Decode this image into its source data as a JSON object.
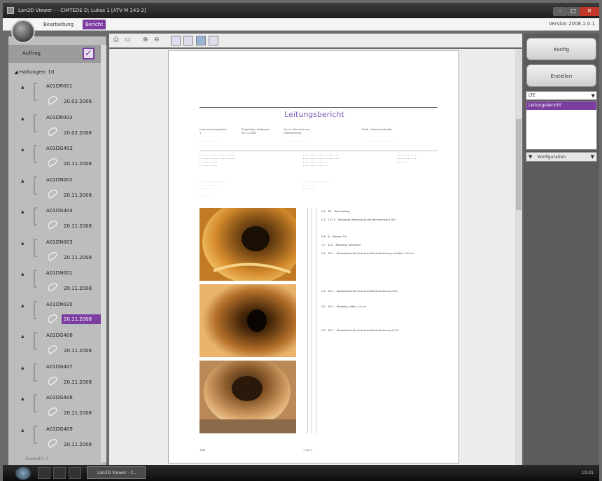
{
  "window": {
    "title": "Lan3D Viewer - - CIMTEDE D; Lukas 1 [ATV M 143-2]",
    "version": "Version 2008.1.0.1"
  },
  "appbar": {
    "tab_bearbeitung": "Bearbeitung",
    "tab_bericht": "Bericht"
  },
  "sidebar": {
    "auftrag_label": "Auftrag",
    "auftrag_checked": true,
    "haltungen_label": "Haltungen: 10",
    "items": [
      {
        "code": "A01DR001",
        "date": "20.02.2008",
        "selected": false
      },
      {
        "code": "A01DR003",
        "date": "20.02.2008",
        "selected": false
      },
      {
        "code": "A01DG403",
        "date": "20.11.2008",
        "selected": false
      },
      {
        "code": "A01DN002",
        "date": "20.11.2008",
        "selected": false
      },
      {
        "code": "A01DG404",
        "date": "20.11.2008",
        "selected": false
      },
      {
        "code": "A01DN003",
        "date": "20.11.2008",
        "selected": false
      },
      {
        "code": "A01DN001",
        "date": "20.11.2008",
        "selected": false
      },
      {
        "code": "A01DN020",
        "date": "20.11.2008",
        "selected": true
      },
      {
        "code": "A01DG406",
        "date": "20.11.2008",
        "selected": false
      },
      {
        "code": "A01DG407",
        "date": "20.11.2008",
        "selected": false
      },
      {
        "code": "A01DG408",
        "date": "20.11.2008",
        "selected": false
      },
      {
        "code": "A01DG409",
        "date": "20.11.2008",
        "selected": false
      }
    ]
  },
  "document": {
    "title": "Leitungsbericht",
    "header_fields": [
      {
        "label": "Untersuchungsdatum",
        "value": "1"
      },
      {
        "label": "Zugehörige Haltungen",
        "value": "20.11.2008"
      },
      {
        "label": "Grund Untersuchung",
        "value": "Untersuchung"
      },
      {
        "label": "Stadt / Gemeindestraße",
        "value": ""
      }
    ],
    "observations": [
      {
        "pos": "0,0",
        "code": "BC",
        "text": "Rohranfang"
      },
      {
        "pos": "0,1",
        "code": "13 LE",
        "text": "Fehlende Verbindung der Rohrleitung 3 Uhr"
      },
      {
        "pos": "0,6",
        "code": "A",
        "text": "Wasser 5%"
      },
      {
        "pos": "1,7",
        "code": "A-G",
        "text": "Abzweig, Standard"
      },
      {
        "pos": "2,6",
        "code": "HF-L",
        "text": "Abzweigschutz Querschnittsveränderung, vertikal, 7,6 cm"
      },
      {
        "pos": "2,8",
        "code": "HF-L",
        "text": "Abzweigschutz Querschnittsveränderung 25%"
      },
      {
        "pos": "3,1",
        "code": "HF-L",
        "text": "Abzweig, offen, 10 cm"
      },
      {
        "pos": "3,2",
        "code": "HF-L",
        "text": "Abzweigschutz Querschnittsveränderung 6,0%"
      }
    ],
    "footer_left": "1/68",
    "footer_mid": "1 von 3"
  },
  "right_panel": {
    "btn_konfig": "Konfig",
    "btn_erstellen": "Erstellen",
    "layout_value": "LTE",
    "layout_items": [
      "Leitungsbericht"
    ],
    "konfiguration_label": "Konfiguration"
  },
  "taskbar": {
    "active_app": "Lan3D Viewer - C...",
    "clock": "10:21"
  },
  "status": {
    "left": "Auswahl: 1"
  },
  "colors": {
    "accent": "#7b3ea0",
    "title_purple": "#7a5bb5"
  }
}
